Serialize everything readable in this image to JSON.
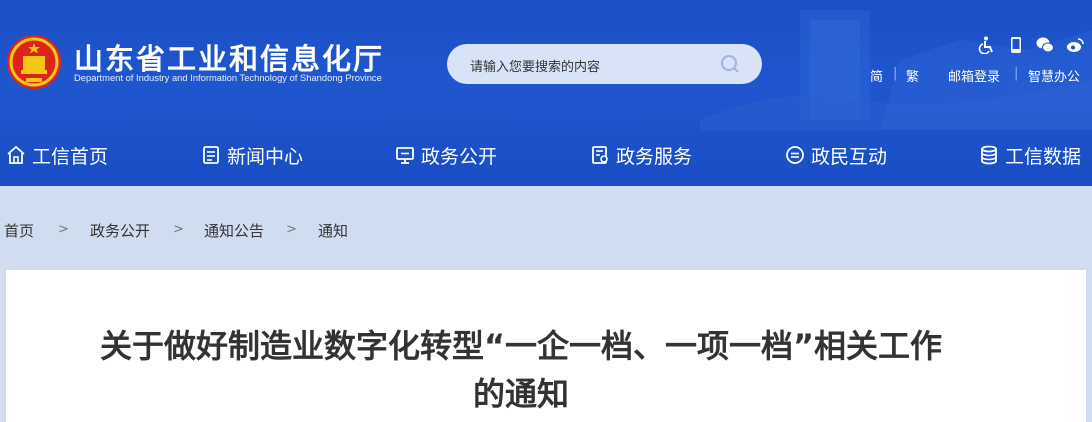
{
  "header": {
    "title": "山东省工业和信息化厅",
    "subtitle": "Department of Industry and Information Technology of Shandong Province",
    "colors": {
      "header_bg": "#1d52c9",
      "page_bg": "#d0ddf1",
      "search_bg": "#d9e3f8"
    }
  },
  "search": {
    "placeholder": "请输入您要搜索的内容"
  },
  "top_icons": [
    "accessibility-icon",
    "mobile-icon",
    "wechat-icon",
    "weibo-icon"
  ],
  "top_links": {
    "simplified": "简",
    "traditional": "繁",
    "mail_login": "邮箱登录",
    "smart_office": "智慧办公"
  },
  "nav": [
    {
      "label": "工信首页",
      "icon": "home-icon"
    },
    {
      "label": "新闻中心",
      "icon": "news-icon"
    },
    {
      "label": "政务公开",
      "icon": "monitor-icon"
    },
    {
      "label": "政务服务",
      "icon": "service-icon"
    },
    {
      "label": "政民互动",
      "icon": "chat-icon"
    },
    {
      "label": "工信数据",
      "icon": "database-icon"
    }
  ],
  "breadcrumb": {
    "items": [
      "首页",
      "政务公开",
      "通知公告",
      "通知"
    ],
    "separator": ">"
  },
  "article": {
    "title": "关于做好制造业数字化转型“一企一档、一项一档”相关工作的通知"
  }
}
